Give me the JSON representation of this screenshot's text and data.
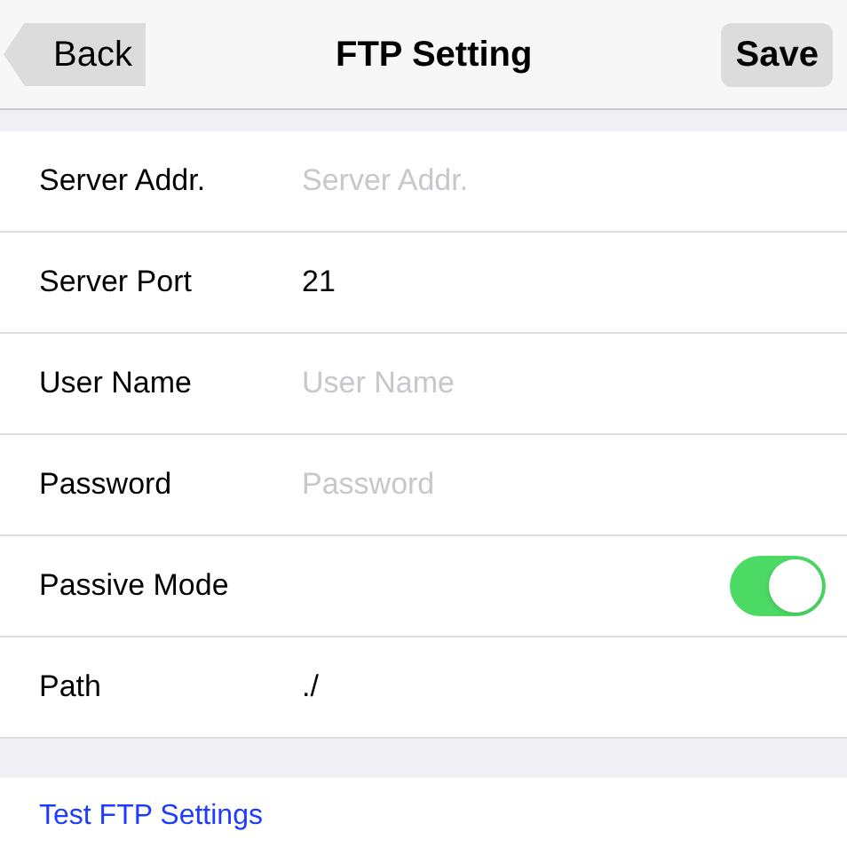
{
  "nav": {
    "back": "Back",
    "title": "FTP Setting",
    "save": "Save"
  },
  "rows": [
    {
      "kind": "field",
      "label": "Server Addr.",
      "placeholder": "Server Addr."
    },
    {
      "kind": "field",
      "label": "Server Port",
      "value": "21"
    },
    {
      "kind": "field",
      "label": "User Name",
      "placeholder": "User Name"
    },
    {
      "kind": "field",
      "label": "Password",
      "placeholder": "Password"
    },
    {
      "kind": "toggle",
      "label": "Passive Mode",
      "on": true
    },
    {
      "kind": "field",
      "label": "Path",
      "value": "./"
    }
  ],
  "link": "Test FTP Settings"
}
